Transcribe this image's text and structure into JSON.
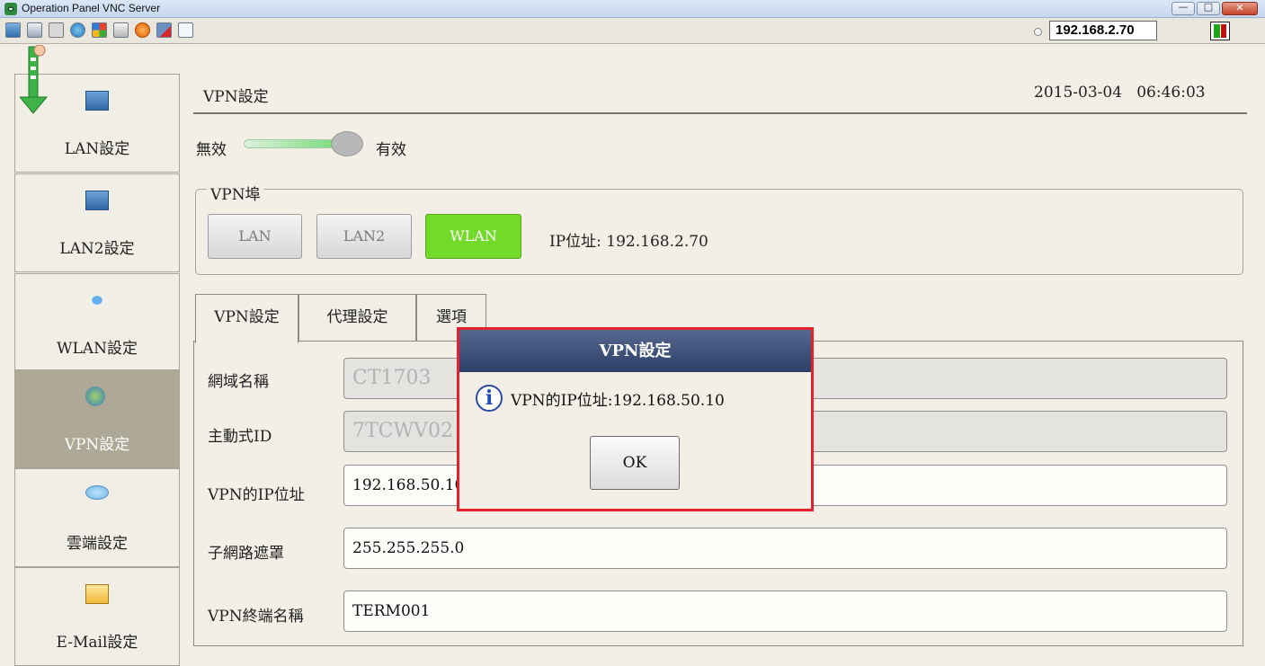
{
  "window": {
    "title": "Operation Panel VNC Server",
    "minimize_glyph": "—",
    "maximize_glyph": "□",
    "close_glyph": "✕"
  },
  "toolbar": {
    "icons": [
      "monitor-icon",
      "tree-icon",
      "tools-icon",
      "refresh-icon",
      "windows-icon",
      "keyboard-icon",
      "alert-icon",
      "network-icon",
      "fullscreen-icon"
    ],
    "server_ip": "192.168.2.70",
    "status_colors": [
      "#1aa81a",
      "#c01010"
    ]
  },
  "sidebar": {
    "items": [
      {
        "label": "LAN設定",
        "icon": "lan-icon",
        "active": false
      },
      {
        "label": "LAN2設定",
        "icon": "lan2-warning-icon",
        "active": false
      },
      {
        "label": "WLAN設定",
        "icon": "wifi-antenna-icon",
        "active": false
      },
      {
        "label": "VPN設定",
        "icon": "vpn-globe-icon",
        "active": true
      },
      {
        "label": "雲端設定",
        "icon": "cloud-icon",
        "active": false
      },
      {
        "label": "E-Mail設定",
        "icon": "mail-icon",
        "active": false
      }
    ]
  },
  "header": {
    "title": "VPN設定",
    "date": "2015-03-04",
    "time": "06:46:03"
  },
  "toggle": {
    "off_label": "無效",
    "on_label": "有效",
    "state": "on"
  },
  "vpn_port": {
    "legend": "VPN埠",
    "buttons": [
      {
        "label": "LAN",
        "selected": false
      },
      {
        "label": "LAN2",
        "selected": false
      },
      {
        "label": "WLAN",
        "selected": true
      }
    ],
    "ip_label": "IP位址:",
    "ip_value": "192.168.2.70"
  },
  "tabs": [
    {
      "label": "VPN設定",
      "active": true
    },
    {
      "label": "代理設定",
      "active": false
    },
    {
      "label": "選項",
      "active": false
    }
  ],
  "fields": [
    {
      "label": "網域名稱",
      "value": "CT1703",
      "disabled": true
    },
    {
      "label": "主動式ID",
      "value": "7TCWV02",
      "disabled": true
    },
    {
      "label": "VPN的IP位址",
      "value": "192.168.50.10",
      "disabled": false
    },
    {
      "label": "子網路遮罩",
      "value": "255.255.255.0",
      "disabled": false
    },
    {
      "label": "VPN終端名稱",
      "value": "TERM001",
      "disabled": false
    }
  ],
  "dialog": {
    "title": "VPN設定",
    "icon": "info-icon",
    "message": "VPN的IP位址:192.168.50.10",
    "ok_label": "OK"
  },
  "colors": {
    "wlan_on": "#73da2a",
    "dialog_border": "#e2232b",
    "dialog_title_bg": "#2c3f68",
    "sidebar_active": "#aea896"
  }
}
